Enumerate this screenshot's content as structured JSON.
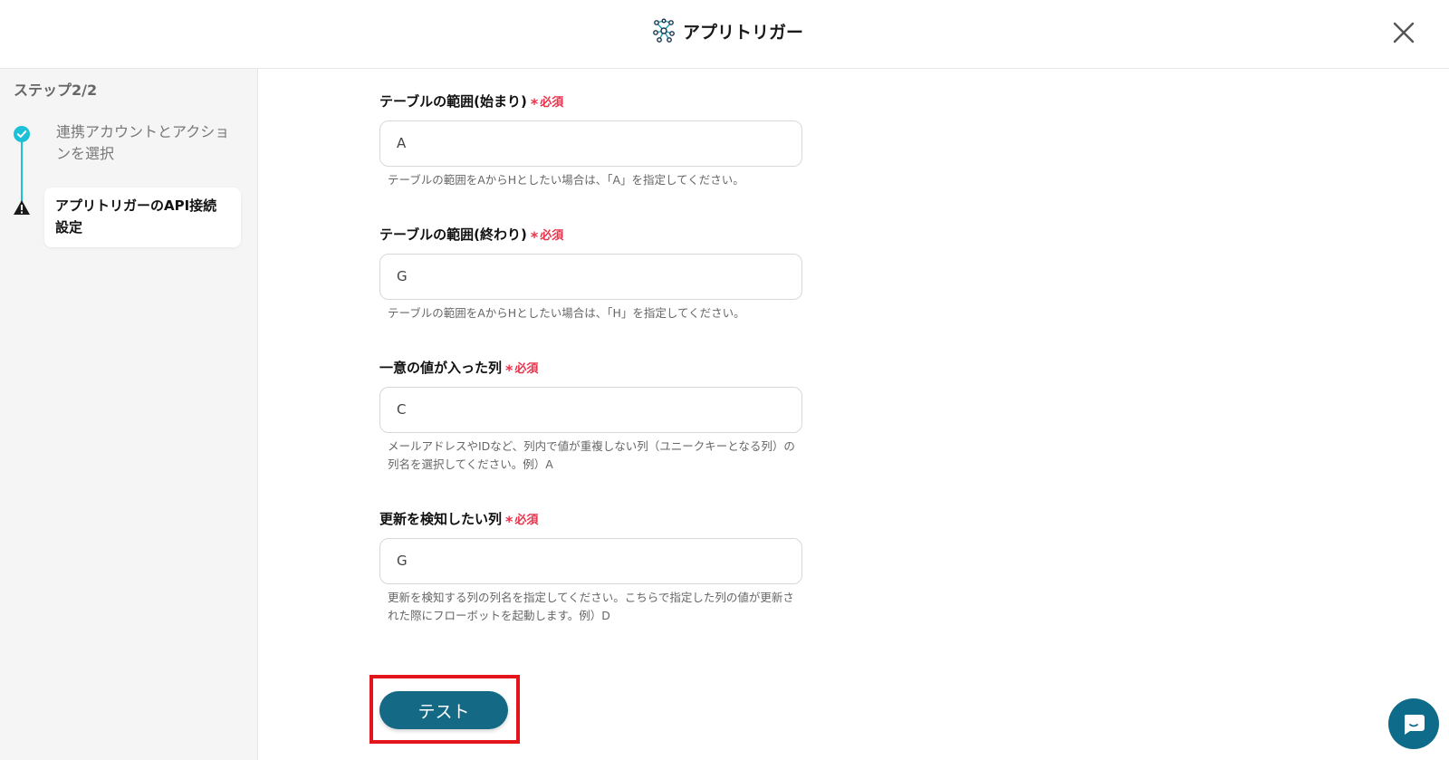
{
  "header": {
    "title": "アプリトリガー",
    "icon": "network-icon",
    "close_icon": "close-icon"
  },
  "sidebar": {
    "step_label": "ステップ2/2",
    "steps": [
      {
        "label": "連携アカウントとアクションを選択",
        "status": "done"
      },
      {
        "label": "アプリトリガーのAPI接続設定",
        "status": "warning"
      }
    ]
  },
  "form": {
    "required_text": "必須",
    "fields": [
      {
        "label": "テーブルの範囲(始まり)",
        "value": "A",
        "help": "テーブルの範囲をAからHとしたい場合は、「A」を指定してください。"
      },
      {
        "label": "テーブルの範囲(終わり)",
        "value": "G",
        "help": "テーブルの範囲をAからHとしたい場合は、「H」を指定してください。"
      },
      {
        "label": "一意の値が入った列",
        "value": "C",
        "help": "メールアドレスやIDなど、列内で値が重複しない列（ユニークキーとなる列）の列名を選択してください。例）A"
      },
      {
        "label": "更新を検知したい列",
        "value": "G",
        "help": "更新を検知する列の列名を指定してください。こちらで指定した列の値が更新された際にフローボットを起動します。例）D"
      }
    ],
    "test_button": "テスト"
  },
  "colors": {
    "accent": "#146a84",
    "required": "#e8324a",
    "highlight": "#e3141c",
    "step_done": "#1cc1d6"
  }
}
